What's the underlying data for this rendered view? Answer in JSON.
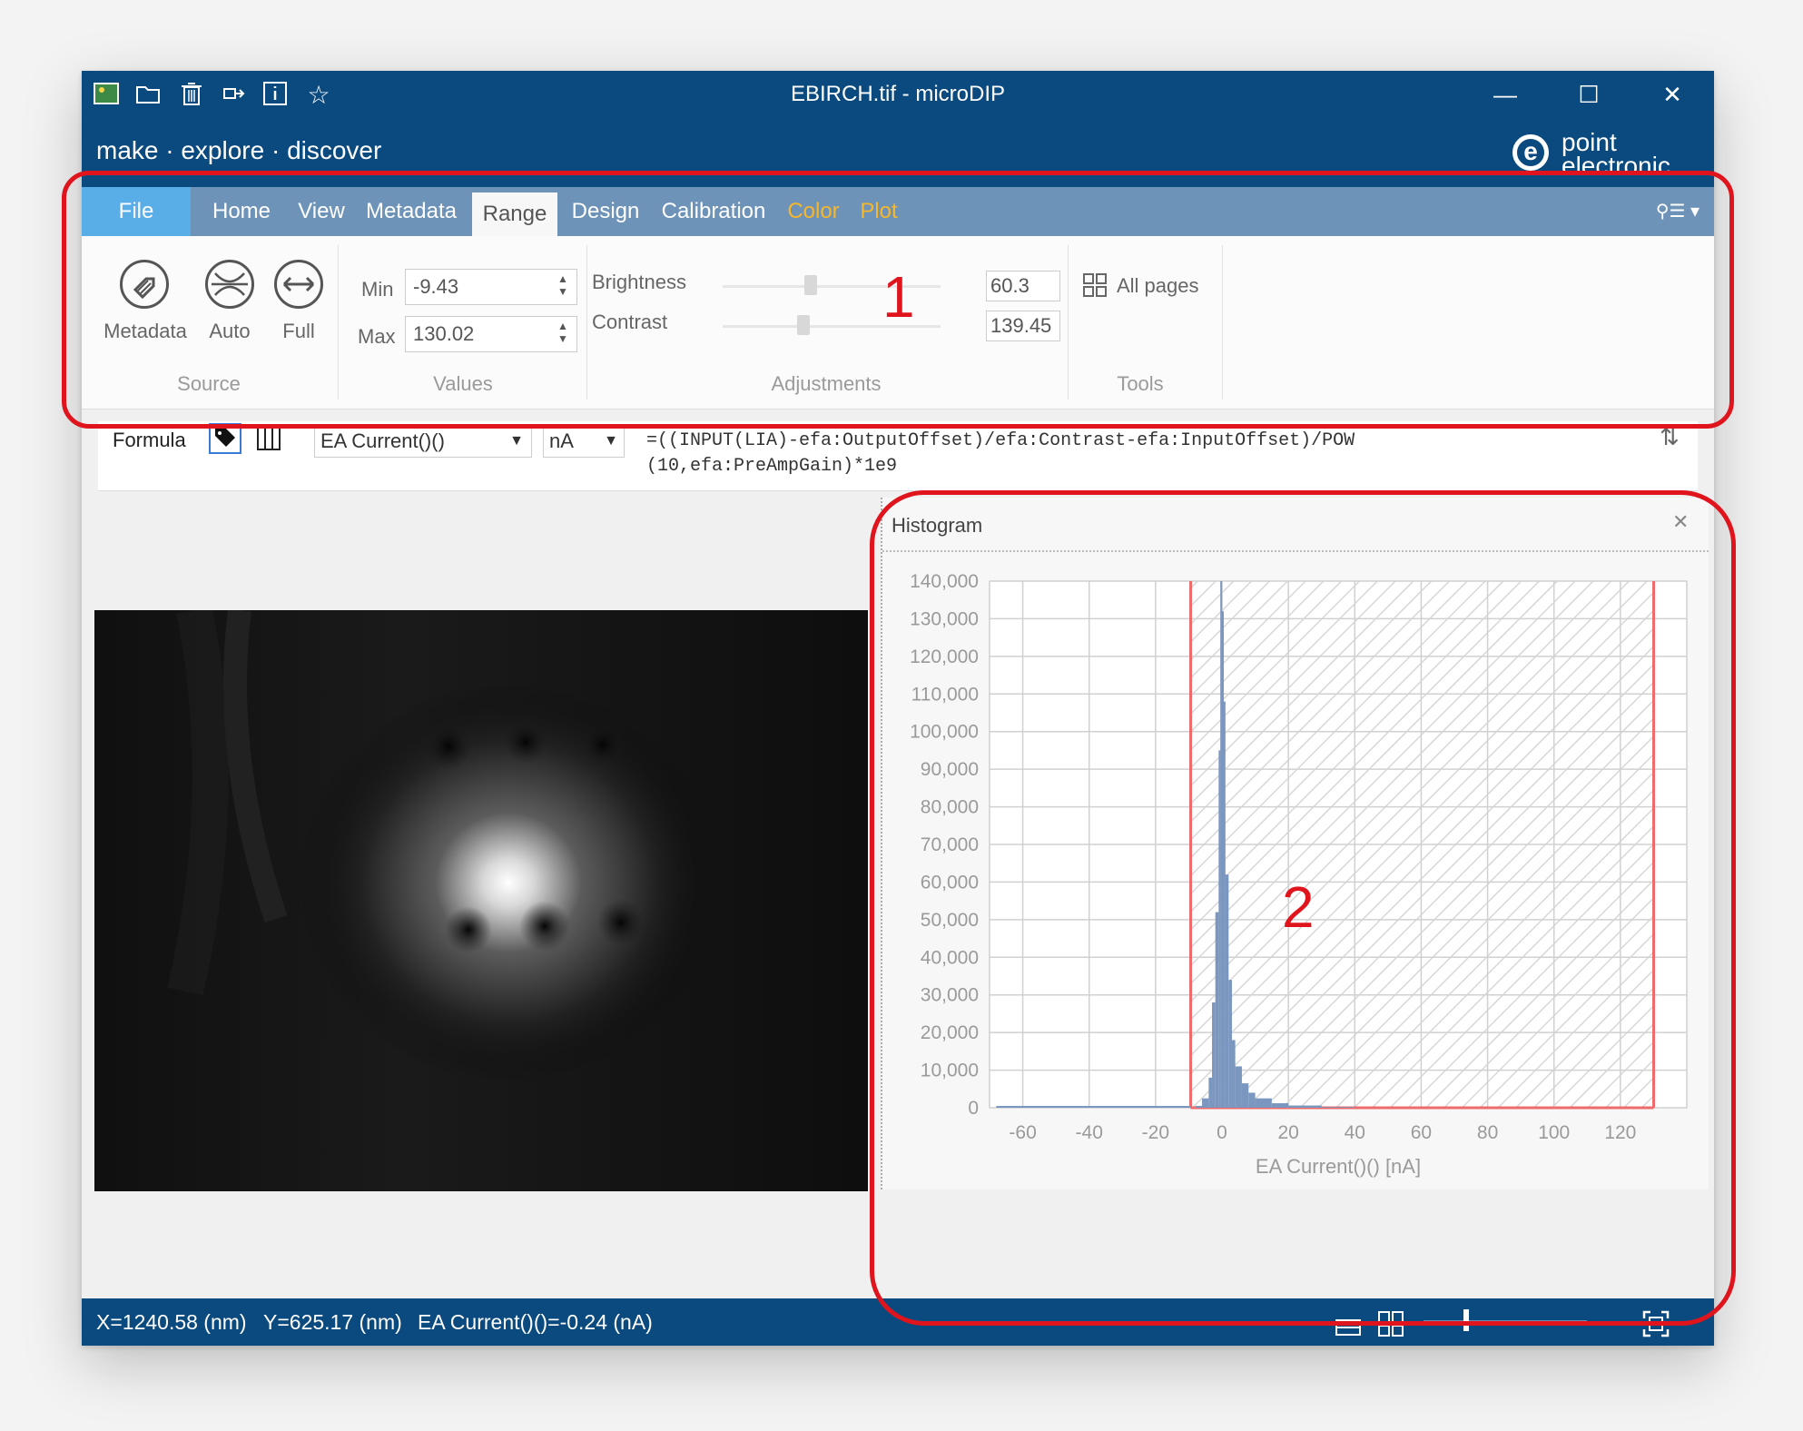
{
  "window": {
    "title": "EBIRCH.tif - microDIP",
    "tagline": "make · explore · discover",
    "logo_text": "point electronic",
    "controls": {
      "minimize": "—",
      "maximize": "☐",
      "close": "✕"
    }
  },
  "quick_access": [
    "image-icon",
    "folder-open-icon",
    "trash-icon",
    "export-icon",
    "info-icon",
    "star-icon"
  ],
  "menu": {
    "tabs": [
      {
        "label": "File",
        "style": "file"
      },
      {
        "label": "Home",
        "style": "normal"
      },
      {
        "label": "View",
        "style": "normal"
      },
      {
        "label": "Metadata",
        "style": "normal"
      },
      {
        "label": "Range",
        "style": "active"
      },
      {
        "label": "Design",
        "style": "normal"
      },
      {
        "label": "Calibration",
        "style": "normal"
      },
      {
        "label": "Color",
        "style": "orange"
      },
      {
        "label": "Plot",
        "style": "orange"
      }
    ],
    "user_menu": "⚲☰ ▾"
  },
  "ribbon": {
    "source": {
      "label": "Source",
      "buttons": [
        "Metadata",
        "Auto",
        "Full"
      ]
    },
    "values": {
      "label": "Values",
      "min_label": "Min",
      "min_value": "-9.43",
      "max_label": "Max",
      "max_value": "130.02"
    },
    "adjustments": {
      "label": "Adjustments",
      "brightness_label": "Brightness",
      "brightness_value": "60.3",
      "contrast_label": "Contrast",
      "contrast_value": "139.45"
    },
    "tools": {
      "label": "Tools",
      "all_pages": "All pages"
    }
  },
  "formula": {
    "label": "Formula",
    "channel": "EA Current()()",
    "unit": "nA",
    "expression_line1": "=((INPUT(LIA)-efa:OutputOffset)/efa:Contrast-efa:InputOffset)/POW",
    "expression_line2": "(10,efa:PreAmpGain)*1e9"
  },
  "histogram": {
    "panel_title": "Histogram",
    "close": "✕"
  },
  "chart_data": {
    "type": "bar",
    "xlabel": "EA Current()() [nA]",
    "ylabel": "",
    "title": "",
    "xlim": [
      -70,
      140
    ],
    "ylim": [
      0,
      140000
    ],
    "x_ticks": [
      -60,
      -40,
      -20,
      0,
      20,
      40,
      60,
      80,
      100,
      120
    ],
    "y_ticks": [
      0,
      10000,
      20000,
      30000,
      40000,
      50000,
      60000,
      70000,
      80000,
      90000,
      100000,
      110000,
      120000,
      130000,
      140000
    ],
    "y_tick_labels": [
      "0",
      "10,000",
      "20,000",
      "30,000",
      "40,000",
      "50,000",
      "60,000",
      "70,000",
      "80,000",
      "90,000",
      "100,000",
      "110,000",
      "120,000",
      "130,000",
      "140,000"
    ],
    "x": [
      -8,
      -6,
      -4,
      -3,
      -2,
      -1,
      -0.5,
      0,
      0.5,
      1,
      2,
      3,
      4,
      6,
      8,
      10,
      15,
      20,
      30
    ],
    "values": [
      500,
      2500,
      8000,
      28000,
      52000,
      95000,
      140000,
      132000,
      108000,
      62000,
      34000,
      18000,
      11000,
      6500,
      4000,
      2500,
      1200,
      600,
      200
    ],
    "range_min": -9.43,
    "range_max": 130.02,
    "grid": true,
    "bar_color": "#7b97bf",
    "range_color": "#ef6b6b"
  },
  "status": {
    "x": "X=1240.58 (nm)",
    "y": "Y=625.17 (nm)",
    "value": "EA Current()()=-0.24 (nA)"
  },
  "annotations": {
    "callout_1": "1",
    "callout_2": "2",
    "color": "#e0141c"
  }
}
